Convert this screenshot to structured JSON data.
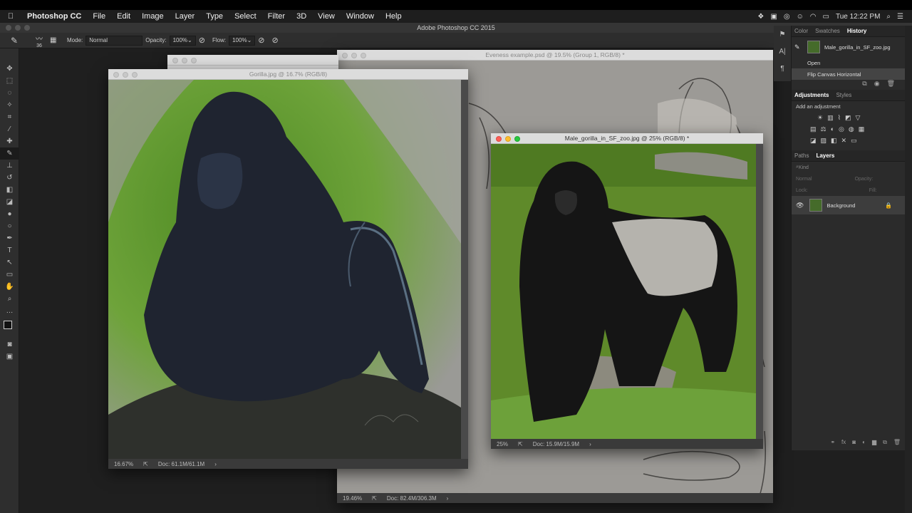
{
  "menubar": {
    "apple": "",
    "items": [
      "Photoshop CC",
      "File",
      "Edit",
      "Image",
      "Layer",
      "Type",
      "Select",
      "Filter",
      "3D",
      "View",
      "Window",
      "Help"
    ],
    "time": "Tue 12:22 PM"
  },
  "app_title": "Adobe Photoshop CC 2015",
  "options": {
    "brush_size": "36",
    "mode_label": "Mode:",
    "mode_value": "Normal",
    "opacity_label": "Opacity:",
    "opacity_value": "100%",
    "flow_label": "Flow:",
    "flow_value": "100%"
  },
  "windows": {
    "gorilla": {
      "title": "Gorilla.jpg @ 16.7% (RGB/8)",
      "zoom": "16.67%",
      "doc": "Doc: 61.1M/61.1M",
      "signature": "Aaron Blaise"
    },
    "eveness": {
      "title": "Eveness example.psd @ 19.5% (Group 1, RGB/8) *",
      "zoom": "19.46%",
      "doc": "Doc: 82.4M/306.3M"
    },
    "male": {
      "title": "Male_gorilla_in_SF_zoo.jpg @ 25% (RGB/8) *",
      "zoom": "25%",
      "doc": "Doc: 15.9M/15.9M"
    }
  },
  "panels": {
    "top_tabs": [
      "Color",
      "Swatches",
      "History"
    ],
    "history_snapshot": "Male_gorilla_in_SF_zoo.jpg",
    "history_items": [
      "Open",
      "Flip Canvas Horizontal"
    ],
    "adj_tabs": [
      "Adjustments",
      "Styles"
    ],
    "adj_hint": "Add an adjustment",
    "layer_tabs": [
      "Paths",
      "Layers"
    ],
    "kind": "Kind",
    "blend": "Normal",
    "opacity": "Opacity:",
    "lock": "Lock:",
    "fill": "Fill:",
    "layer_name": "Background"
  },
  "colors": {
    "accent": "#6a9c2e",
    "photo_grass": "#5f8a2a"
  }
}
